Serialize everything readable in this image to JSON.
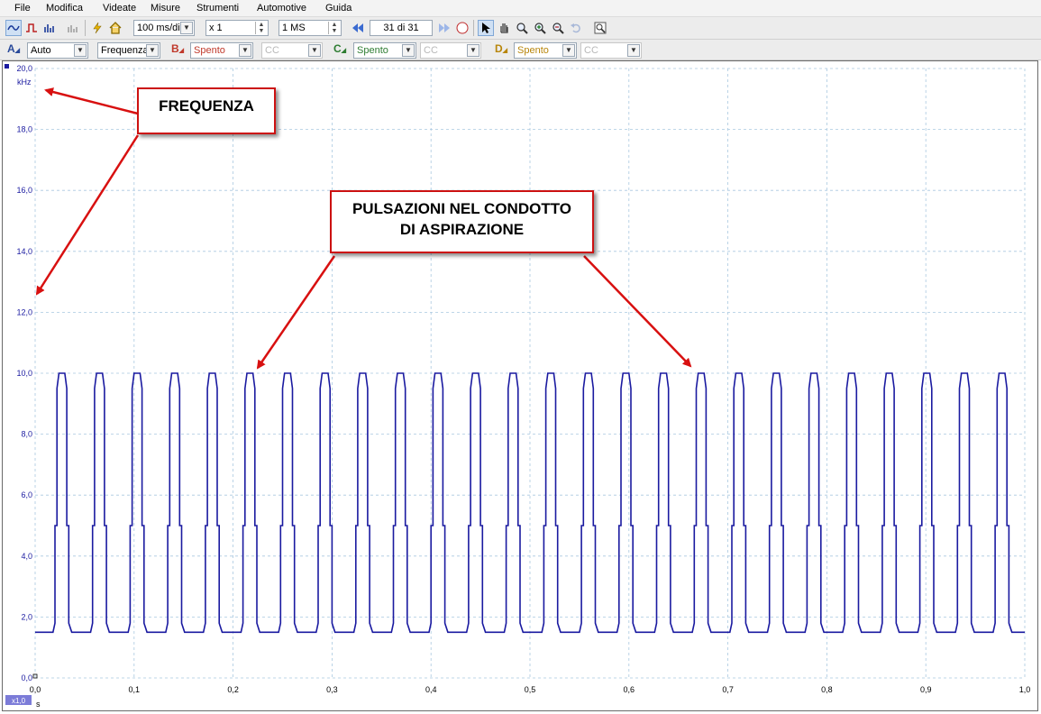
{
  "menu": [
    "File",
    "Modifica",
    "Videate",
    "Misure",
    "Strumenti",
    "Automotive",
    "Guida"
  ],
  "toolbar": {
    "timebase": "100 ms/div",
    "zoom": "x 1",
    "samples": "1 MS",
    "buffer": "31  di 31"
  },
  "channels": {
    "a": {
      "label": "A",
      "range": "Auto",
      "mode": "Frequenza",
      "color": "#2a4a9a"
    },
    "b": {
      "label": "B",
      "range": "Spento",
      "coupling": "CC",
      "color": "#c0392b"
    },
    "c": {
      "label": "C",
      "range": "Spento",
      "coupling": "CC",
      "color": "#2e7d32"
    },
    "d": {
      "label": "D",
      "range": "Spento",
      "coupling": "CC",
      "color": "#b8860b"
    }
  },
  "chart_data": {
    "type": "line",
    "ylabel": "kHz",
    "xlabel": "s",
    "xlim": [
      0.0,
      1.0
    ],
    "ylim": [
      0.0,
      20.0
    ],
    "yticks": [
      "0,0",
      "2,0",
      "4,0",
      "6,0",
      "8,0",
      "10,0",
      "12,0",
      "14,0",
      "16,0",
      "18,0",
      "20,0"
    ],
    "xticks": [
      "0,0",
      "0,1",
      "0,2",
      "0,3",
      "0,4",
      "0,5",
      "0,6",
      "0,7",
      "0,8",
      "0,9",
      "1,0"
    ],
    "grid": true,
    "series": [
      {
        "color": "#1a1aa0",
        "pulse_starts": [
          0.018,
          0.056,
          0.094,
          0.132,
          0.17,
          0.208,
          0.246,
          0.284,
          0.322,
          0.36,
          0.398,
          0.436,
          0.474,
          0.512,
          0.55,
          0.588,
          0.626,
          0.664,
          0.702,
          0.74,
          0.778,
          0.816,
          0.854,
          0.892,
          0.93,
          0.968,
          1.006
        ],
        "baseline": 1.5,
        "peak": 10.0,
        "step_level": 5.0
      }
    ],
    "scale_badge": "x1,0"
  },
  "annotations": {
    "frequenza": "FREQUENZA",
    "pulsazioni_line1": "PULSAZIONI NEL CONDOTTO",
    "pulsazioni_line2": "DI ASPIRAZIONE"
  }
}
